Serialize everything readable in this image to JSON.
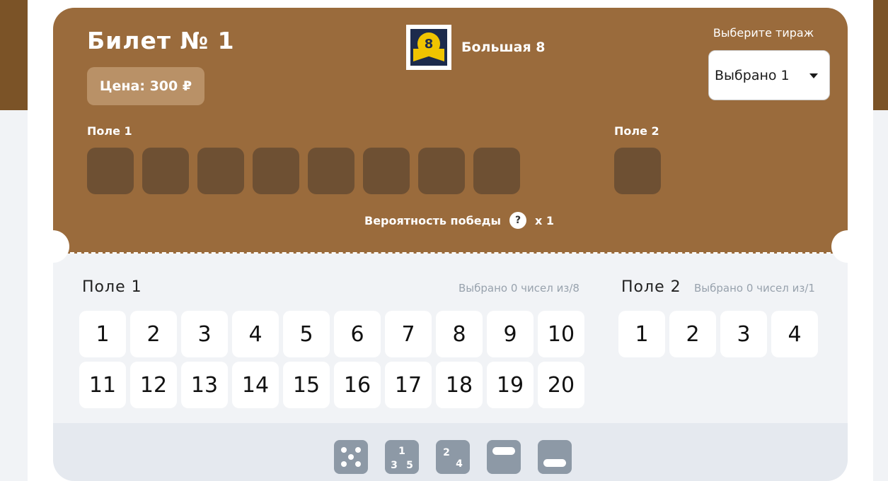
{
  "ticket": {
    "title": "Билет № 1",
    "price": "Цена: 300 ₽",
    "lottery_name": "Большая 8",
    "lottery_logo_glyph": "8"
  },
  "draw": {
    "label": "Выберите тираж",
    "selected": "Выбрано 1"
  },
  "top_fields": {
    "field1_label": "Поле 1",
    "field2_label": "Поле 2",
    "field1_slots": 8,
    "field2_slots": 1
  },
  "probability": {
    "label": "Вероятность победы",
    "help_icon": "?",
    "multiplier": "x 1"
  },
  "field1": {
    "title": "Поле 1",
    "count": "Выбрано 0 чисел из/8",
    "numbers": [
      "1",
      "2",
      "3",
      "4",
      "5",
      "6",
      "7",
      "8",
      "9",
      "10",
      "11",
      "12",
      "13",
      "14",
      "15",
      "16",
      "17",
      "18",
      "19",
      "20"
    ]
  },
  "field2": {
    "title": "Поле 2",
    "count": "Выбрано 0 чисел из/1",
    "numbers": [
      "1",
      "2",
      "3",
      "4"
    ]
  },
  "tools": [
    {
      "name": "random-dice-icon"
    },
    {
      "name": "odd-numbers-icon",
      "text": [
        "1",
        "3",
        "5"
      ]
    },
    {
      "name": "even-numbers-icon",
      "text": [
        "2",
        "4"
      ]
    },
    {
      "name": "upper-half-icon"
    },
    {
      "name": "lower-half-icon"
    }
  ],
  "colors": {
    "ticket_top": "#9a6b3c",
    "slot": "#6e5033",
    "price_badge": "#b99167",
    "tool": "#8d99a6",
    "logo_yellow": "#f0c400",
    "logo_navy": "#1c2b4c"
  }
}
